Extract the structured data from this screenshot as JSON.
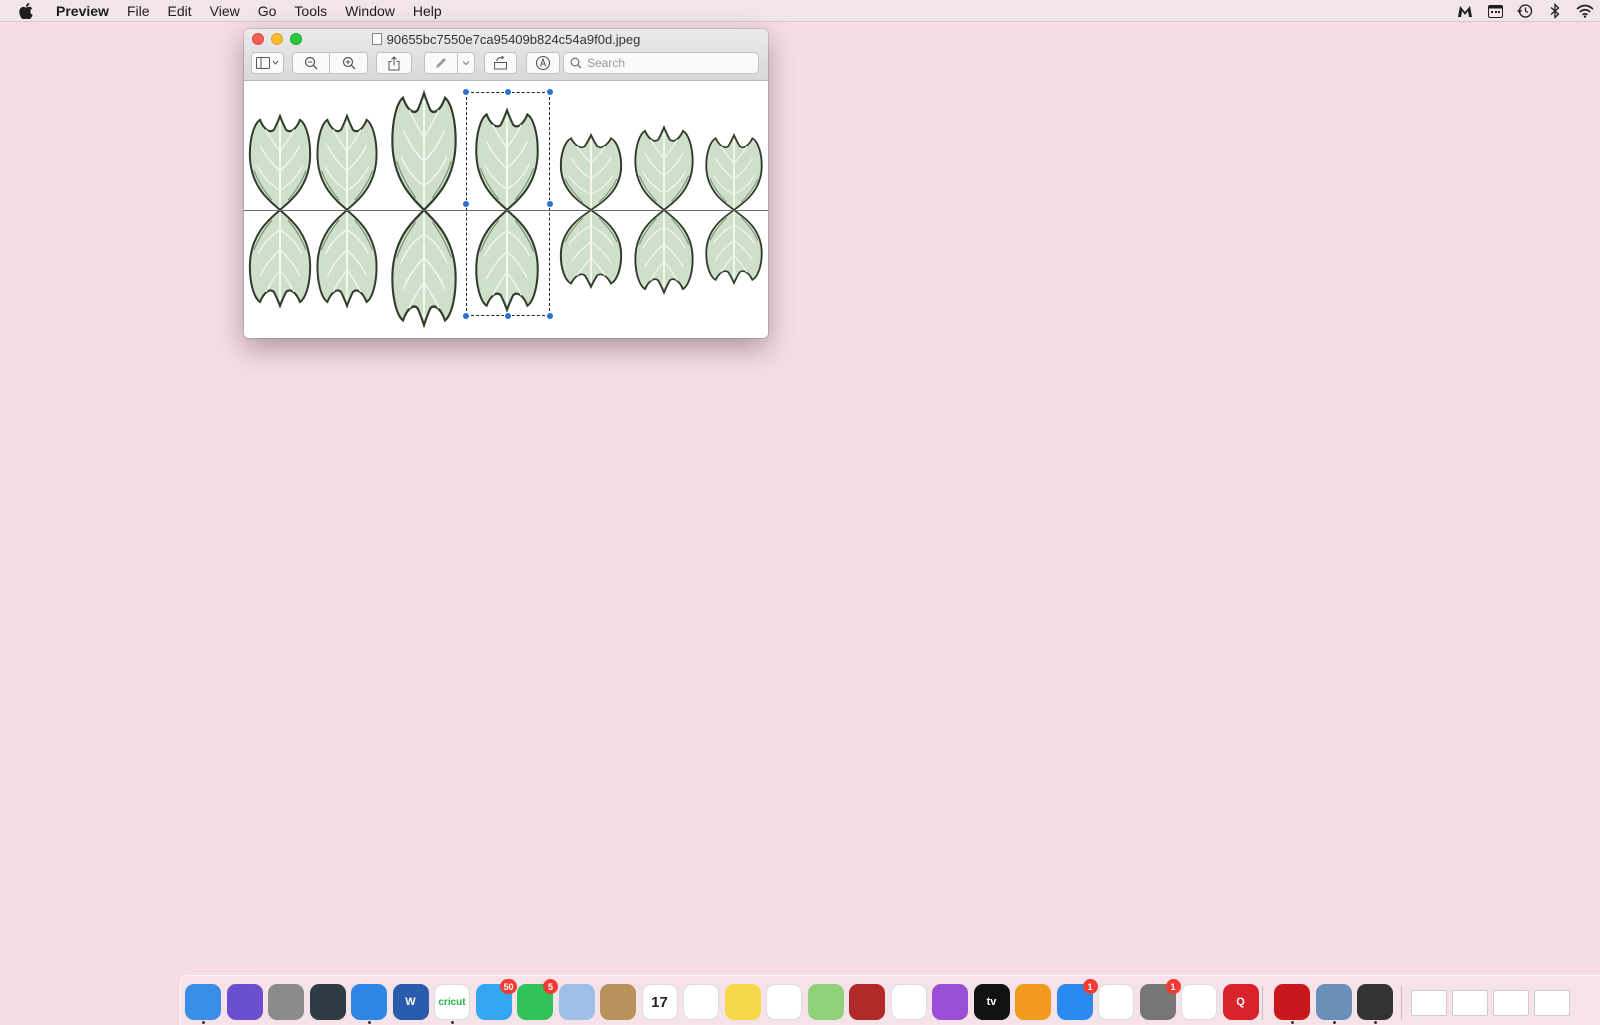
{
  "menubar": {
    "app_name": "Preview",
    "items": [
      "File",
      "Edit",
      "View",
      "Go",
      "Tools",
      "Window",
      "Help"
    ],
    "status_icons": [
      "malwarebytes-icon",
      "calendar-widget-icon",
      "time-machine-icon",
      "bluetooth-icon",
      "wifi-icon"
    ]
  },
  "window": {
    "title": "90655bc7550e7ca95409b824c54a9f0d.jpeg",
    "search_placeholder": "Search",
    "toolbar": [
      "sidebar-toggle",
      "zoom-out",
      "zoom-in",
      "share",
      "markup-pen",
      "rotate",
      "annotate"
    ]
  },
  "dock": {
    "apps": [
      {
        "name": "Finder",
        "icon": "finder-icon",
        "color": "#3a8ee8",
        "running": true
      },
      {
        "name": "Siri",
        "icon": "siri-icon",
        "color": "#6a4fd0",
        "running": false
      },
      {
        "name": "Launchpad",
        "icon": "rocket-icon",
        "color": "#8b8b8b",
        "running": false
      },
      {
        "name": "Mission Control",
        "icon": "mission-control-icon",
        "color": "#2f3a44",
        "running": false
      },
      {
        "name": "Safari",
        "icon": "safari-icon",
        "color": "#2d86e3",
        "running": true
      },
      {
        "name": "Word",
        "icon": "word-icon",
        "color": "#2a5cae",
        "running": false,
        "label": "W"
      },
      {
        "name": "Cricut",
        "icon": "cricut-icon",
        "color": "#ffffff",
        "running": true,
        "label": "cricut"
      },
      {
        "name": "Messages",
        "icon": "messages-icon",
        "color": "#35a7f2",
        "running": false,
        "badge": "50"
      },
      {
        "name": "FaceTime",
        "icon": "facetime-icon",
        "color": "#32c25a",
        "running": false,
        "badge": "5"
      },
      {
        "name": "Mail",
        "icon": "mail-icon",
        "color": "#9ec0e6",
        "running": false
      },
      {
        "name": "Contacts",
        "icon": "contacts-icon",
        "color": "#b8925a",
        "running": false
      },
      {
        "name": "Calendar",
        "icon": "calendar-icon",
        "color": "#ffffff",
        "running": false,
        "label": "17"
      },
      {
        "name": "Reminders",
        "icon": "reminders-icon",
        "color": "#ffffff",
        "running": false
      },
      {
        "name": "Notes",
        "icon": "notes-icon",
        "color": "#f7d84a",
        "running": false
      },
      {
        "name": "Photos",
        "icon": "photos-icon",
        "color": "#ffffff",
        "running": false
      },
      {
        "name": "Maps",
        "icon": "maps-icon",
        "color": "#8fd07a",
        "running": false
      },
      {
        "name": "Photo Booth",
        "icon": "photo-booth-icon",
        "color": "#b02a2a",
        "running": false
      },
      {
        "name": "News",
        "icon": "news-icon",
        "color": "#ffffff",
        "running": false
      },
      {
        "name": "Podcasts",
        "icon": "podcasts-icon",
        "color": "#9b4fd6",
        "running": false
      },
      {
        "name": "Apple TV",
        "icon": "tv-icon",
        "color": "#111111",
        "running": false,
        "label": "tv"
      },
      {
        "name": "Books",
        "icon": "books-icon",
        "color": "#f29a1e",
        "running": false
      },
      {
        "name": "App Store",
        "icon": "app-store-icon",
        "color": "#2a8af0",
        "running": false,
        "badge": "1"
      },
      {
        "name": "Music",
        "icon": "music-icon",
        "color": "#ffffff",
        "running": false
      },
      {
        "name": "System Preferences",
        "icon": "gear-icon",
        "color": "#777777",
        "running": false,
        "badge": "1"
      },
      {
        "name": "Chrome",
        "icon": "chrome-icon",
        "color": "#ffffff",
        "running": false
      },
      {
        "name": "Quicken",
        "icon": "quicken-icon",
        "color": "#d8232a",
        "running": false,
        "label": "Q"
      },
      {
        "name": "Acrobat",
        "icon": "acrobat-icon",
        "color": "#c8181e",
        "running": true
      },
      {
        "name": "Preview",
        "icon": "preview-icon",
        "color": "#6a8fb8",
        "running": true
      },
      {
        "name": "Inkscape",
        "icon": "inkscape-icon",
        "color": "#333333",
        "running": true
      }
    ],
    "minimized": [
      "minimized-window-1",
      "minimized-window-2",
      "minimized-window-3",
      "minimized-window-4"
    ]
  }
}
